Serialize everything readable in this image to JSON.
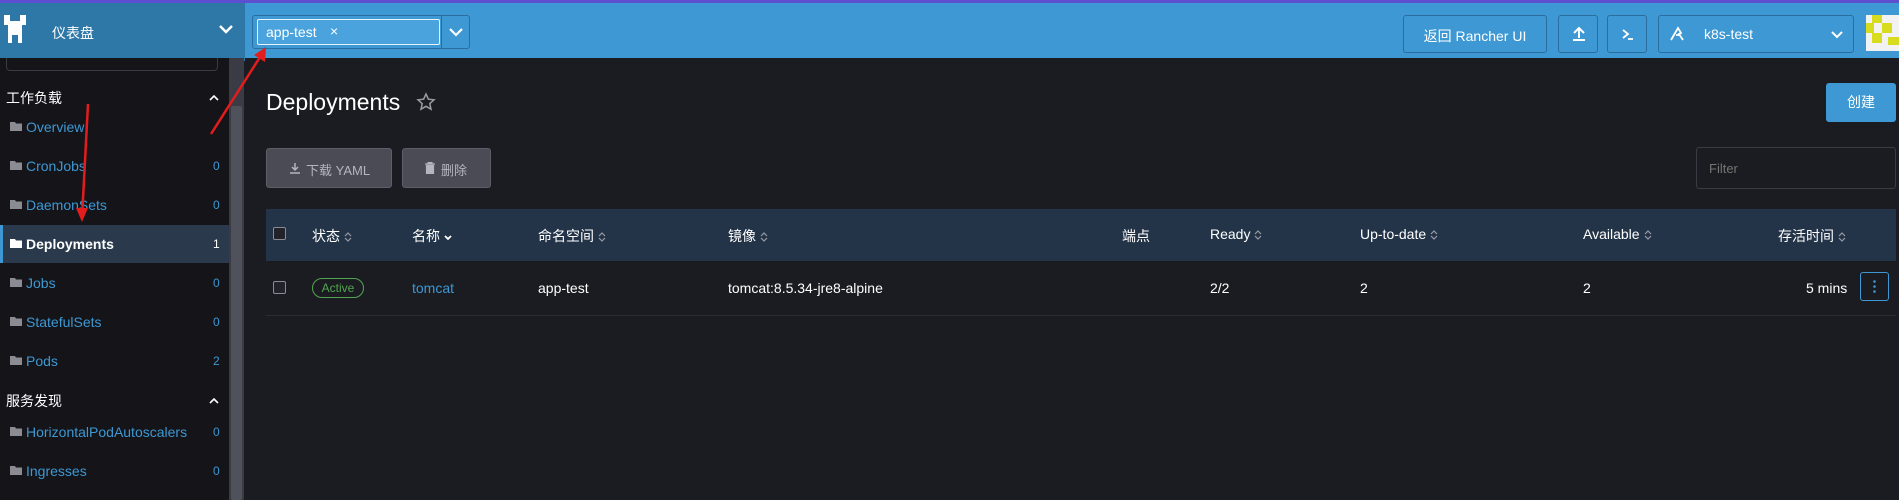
{
  "header": {
    "app_title": "仪表盘",
    "namespace_tag": "app-test",
    "namespace_remove": "×",
    "back_button": "返回 Rancher UI",
    "cluster_name": "k8s-test"
  },
  "sidebar": {
    "groups": [
      {
        "label": "工作负载"
      },
      {
        "label": "服务发现"
      }
    ],
    "items": [
      {
        "label": "Overview",
        "count": ""
      },
      {
        "label": "CronJobs",
        "count": "0"
      },
      {
        "label": "DaemonSets",
        "count": "0"
      },
      {
        "label": "Deployments",
        "count": "1"
      },
      {
        "label": "Jobs",
        "count": "0"
      },
      {
        "label": "StatefulSets",
        "count": "0"
      },
      {
        "label": "Pods",
        "count": "2"
      },
      {
        "label": "HorizontalPodAutoscalers",
        "count": "0"
      },
      {
        "label": "Ingresses",
        "count": "0"
      }
    ]
  },
  "main": {
    "title": "Deployments",
    "create_label": "创建",
    "download_yaml_label": "下载 YAML",
    "delete_label": "删除",
    "filter_placeholder": "Filter",
    "columns": [
      "状态",
      "名称",
      "命名空间",
      "镜像",
      "端点",
      "Ready",
      "Up-to-date",
      "Available",
      "存活时间"
    ],
    "rows": [
      {
        "status": "Active",
        "name": "tomcat",
        "namespace": "app-test",
        "image": "tomcat:8.5.34-jre8-alpine",
        "endpoints": "",
        "ready": "2/2",
        "up_to_date": "2",
        "available": "2",
        "age": "5 mins"
      }
    ]
  },
  "colors": {
    "header": "#3d98d3",
    "accent": "#3d98d3",
    "active_badge": "#52a550",
    "annotation_arrow": "#e11d1d"
  }
}
